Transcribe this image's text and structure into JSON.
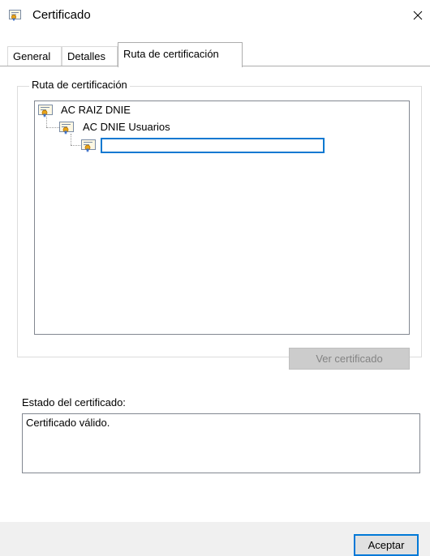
{
  "window": {
    "title": "Certificado",
    "title_icon": "certificate-icon",
    "close_icon": "close-icon"
  },
  "tabs": [
    {
      "label": "General",
      "active": false
    },
    {
      "label": "Detalles",
      "active": false
    },
    {
      "label": "Ruta de certificación",
      "active": true
    }
  ],
  "path_group": {
    "legend": "Ruta de certificación",
    "nodes": [
      {
        "label": "AC RAIZ DNIE",
        "level": 0,
        "icon": "certificate-icon"
      },
      {
        "label": "AC DNIE Usuarios",
        "level": 1,
        "icon": "certificate-icon"
      },
      {
        "label": "",
        "level": 2,
        "icon": "certificate-icon",
        "editing": true
      }
    ],
    "view_button": {
      "label": "Ver certificado",
      "enabled": false
    }
  },
  "status": {
    "label": "Estado del certificado:",
    "value": "Certificado válido."
  },
  "footer": {
    "accept_label": "Aceptar"
  },
  "colors": {
    "focus_border": "#0078d7",
    "footer_bg": "#f0f0f0",
    "disabled_button_bg": "#cccccc"
  }
}
